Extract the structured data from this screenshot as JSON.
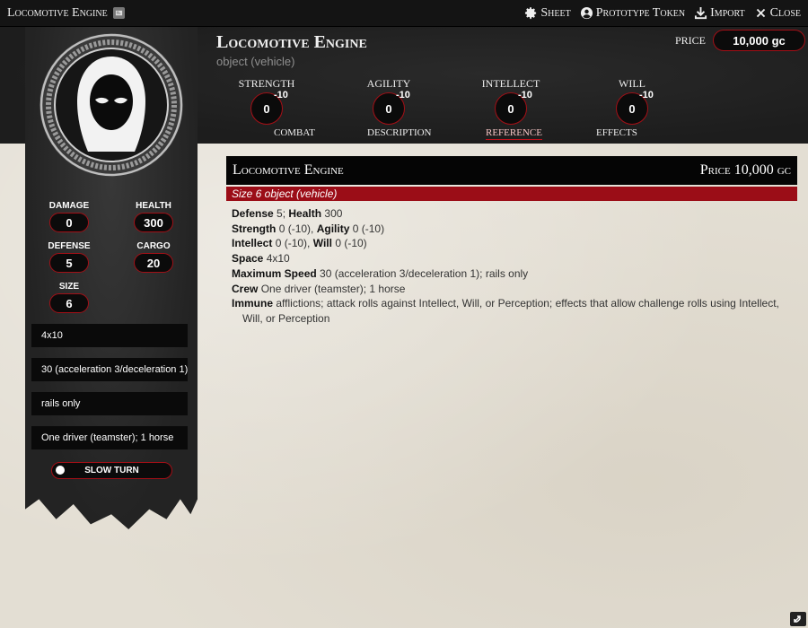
{
  "window": {
    "title": "Locomotive Engine",
    "controls": [
      {
        "label": "Sheet",
        "icon": "gear-icon"
      },
      {
        "label": "Prototype Token",
        "icon": "user-circle-icon"
      },
      {
        "label": "Import",
        "icon": "download-icon"
      },
      {
        "label": "Close",
        "icon": "close-icon"
      }
    ]
  },
  "header": {
    "name": "Locomotive Engine",
    "subtitle": "object (vehicle)",
    "price_label": "Price",
    "price_value": "10,000 gc",
    "attributes": [
      {
        "label": "Strength",
        "value": "0",
        "mod": "-10"
      },
      {
        "label": "Agility",
        "value": "0",
        "mod": "-10"
      },
      {
        "label": "Intellect",
        "value": "0",
        "mod": "-10"
      },
      {
        "label": "Will",
        "value": "0",
        "mod": "-10"
      }
    ],
    "tabs": [
      {
        "label": "Combat",
        "active": false
      },
      {
        "label": "Description",
        "active": false
      },
      {
        "label": "Reference",
        "active": true
      },
      {
        "label": "Effects",
        "active": false
      }
    ]
  },
  "sidebar": {
    "stats": {
      "damage": {
        "label": "Damage",
        "value": "0"
      },
      "health": {
        "label": "Health",
        "value": "300"
      },
      "defense": {
        "label": "Defense",
        "value": "5"
      },
      "cargo": {
        "label": "Cargo",
        "value": "20"
      },
      "size": {
        "label": "Size",
        "value": "6"
      }
    },
    "fields": [
      "4x10",
      "30 (acceleration 3/deceleration 1)",
      "rails only",
      "One driver (teamster); 1 horse"
    ],
    "toggle_label": "Slow Turn",
    "toggle_on": false
  },
  "reference": {
    "title": "Locomotive Engine",
    "price": "Price 10,000 gc",
    "subtitle": "Size 6 object (vehicle)",
    "lines": {
      "defense_label": "Defense",
      "defense_value": "5;",
      "health_label": "Health",
      "health_value": "300",
      "strength_label": "Strength",
      "strength_value": "0 (-10),",
      "agility_label": "Agility",
      "agility_value": "0 (-10)",
      "intellect_label": "Intellect",
      "intellect_value": "0 (-10),",
      "will_label": "Will",
      "will_value": "0 (-10)",
      "space_label": "Space",
      "space_value": "4x10",
      "speed_label": "Maximum Speed",
      "speed_value": "30 (acceleration 3/deceleration 1); rails only",
      "crew_label": "Crew",
      "crew_value": "One driver (teamster); 1 horse",
      "immune_label": "Immune",
      "immune_value_1": "afflictions; attack rolls against Intellect, Will, or Perception; effects that allow challenge rolls using Intellect,",
      "immune_value_2": "Will, or Perception"
    }
  },
  "colors": {
    "accent": "#a30f16",
    "header_bg": "#1d1d1d",
    "parchment": "#e3ded3"
  }
}
